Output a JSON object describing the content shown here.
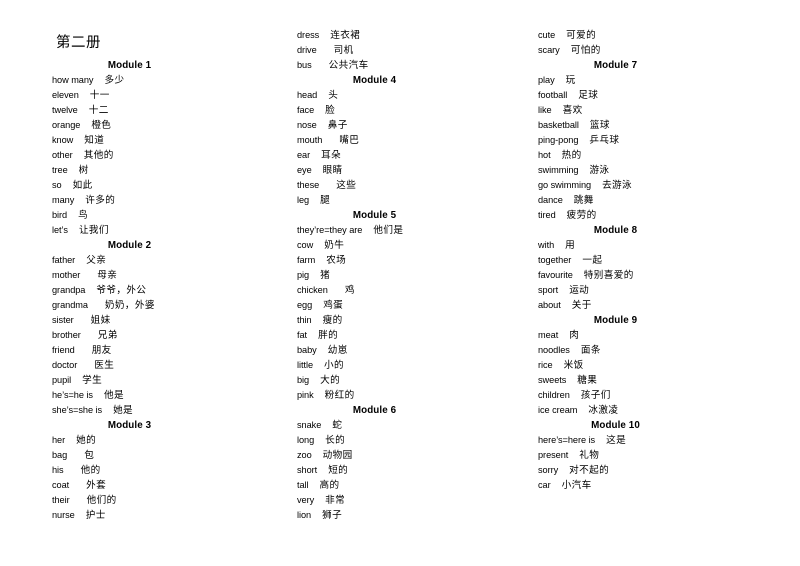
{
  "document": {
    "title": "第二册"
  },
  "columns": [
    {
      "id": "column-1",
      "blocks": [
        {
          "type": "module",
          "label": "Module 1"
        },
        {
          "type": "entry",
          "en": "how  many",
          "gap": "md",
          "zh": "多少"
        },
        {
          "type": "entry",
          "en": "eleven",
          "gap": "md",
          "zh": "十一"
        },
        {
          "type": "entry",
          "en": "twelve",
          "gap": "md",
          "zh": "十二"
        },
        {
          "type": "entry",
          "en": "orange",
          "gap": "md",
          "zh": "橙色"
        },
        {
          "type": "entry",
          "en": "know",
          "gap": "md",
          "zh": "知道"
        },
        {
          "type": "entry",
          "en": "other",
          "gap": "md",
          "zh": "其他的"
        },
        {
          "type": "entry",
          "en": "tree",
          "gap": "md",
          "zh": "树"
        },
        {
          "type": "entry",
          "en": "so",
          "gap": "md",
          "zh": "如此"
        },
        {
          "type": "entry",
          "en": "many",
          "gap": "md",
          "zh": "许多的"
        },
        {
          "type": "entry",
          "en": "bird",
          "gap": "md",
          "zh": "鸟"
        },
        {
          "type": "entry",
          "en": "let’s",
          "gap": "md",
          "zh": "让我们"
        },
        {
          "type": "module",
          "label": "Module 2"
        },
        {
          "type": "entry",
          "en": "father",
          "gap": "md",
          "zh": "父亲"
        },
        {
          "type": "entry",
          "en": "mother",
          "gap": "lg",
          "zh": "母亲"
        },
        {
          "type": "entry",
          "en": "grandpa",
          "gap": "md",
          "zh": "爷爷，外公"
        },
        {
          "type": "entry",
          "en": "grandma",
          "gap": "lg",
          "zh": "奶奶，外婆"
        },
        {
          "type": "entry",
          "en": "sister",
          "gap": "lg",
          "zh": "姐妹"
        },
        {
          "type": "entry",
          "en": "brother",
          "gap": "lg",
          "zh": "兄弟"
        },
        {
          "type": "entry",
          "en": "friend",
          "gap": "lg",
          "zh": "朋友"
        },
        {
          "type": "entry",
          "en": "doctor",
          "gap": "lg",
          "zh": "医生"
        },
        {
          "type": "entry",
          "en": "pupil",
          "gap": "md",
          "zh": "学生"
        },
        {
          "type": "entry",
          "en": "he’s=he   is",
          "gap": "md",
          "zh": "他是"
        },
        {
          "type": "entry",
          "en": "she’s=she   is",
          "gap": "md",
          "zh": "她是"
        },
        {
          "type": "module",
          "label": "Module 3"
        },
        {
          "type": "entry",
          "en": "her",
          "gap": "md",
          "zh": "她的"
        },
        {
          "type": "entry",
          "en": "bag",
          "gap": "lg",
          "zh": "包"
        },
        {
          "type": "entry",
          "en": "his",
          "gap": "lg",
          "zh": "他的"
        },
        {
          "type": "entry",
          "en": "coat",
          "gap": "lg",
          "zh": "外套"
        },
        {
          "type": "entry",
          "en": "their",
          "gap": "lg",
          "zh": "他们的"
        },
        {
          "type": "entry",
          "en": "nurse",
          "gap": "md",
          "zh": "护士"
        }
      ]
    },
    {
      "id": "column-2",
      "blocks": [
        {
          "type": "entry",
          "en": "dress",
          "gap": "md",
          "zh": "连衣裙"
        },
        {
          "type": "entry",
          "en": "drive",
          "gap": "lg",
          "zh": "司机"
        },
        {
          "type": "entry",
          "en": "bus",
          "gap": "lg",
          "zh": "公共汽车"
        },
        {
          "type": "module",
          "label": "Module 4"
        },
        {
          "type": "entry",
          "en": "head",
          "gap": "md",
          "zh": "头"
        },
        {
          "type": "entry",
          "en": "face",
          "gap": "md",
          "zh": "脸"
        },
        {
          "type": "entry",
          "en": "nose",
          "gap": "md",
          "zh": "鼻子"
        },
        {
          "type": "entry",
          "en": "mouth",
          "gap": "lg",
          "zh": "嘴巴"
        },
        {
          "type": "entry",
          "en": "ear",
          "gap": "md",
          "zh": "耳朵"
        },
        {
          "type": "entry",
          "en": "eye",
          "gap": "md",
          "zh": "眼睛"
        },
        {
          "type": "entry",
          "en": "these",
          "gap": "lg",
          "zh": "这些"
        },
        {
          "type": "entry",
          "en": "leg",
          "gap": "md",
          "zh": "腿"
        },
        {
          "type": "module",
          "label": "Module 5"
        },
        {
          "type": "entry",
          "en": "they’re=they   are",
          "gap": "md",
          "zh": "他们是"
        },
        {
          "type": "entry",
          "en": "cow",
          "gap": "md",
          "zh": "奶牛"
        },
        {
          "type": "entry",
          "en": "farm",
          "gap": "md",
          "zh": "农场"
        },
        {
          "type": "entry",
          "en": "pig",
          "gap": "md",
          "zh": "猪"
        },
        {
          "type": "entry",
          "en": "chicken",
          "gap": "lg",
          "zh": "鸡"
        },
        {
          "type": "entry",
          "en": "egg",
          "gap": "md",
          "zh": "鸡蛋"
        },
        {
          "type": "entry",
          "en": "thin",
          "gap": "md",
          "zh": "瘦的"
        },
        {
          "type": "entry",
          "en": "fat",
          "gap": "md",
          "zh": "胖的"
        },
        {
          "type": "entry",
          "en": "baby",
          "gap": "md",
          "zh": "幼崽"
        },
        {
          "type": "entry",
          "en": "little",
          "gap": "md",
          "zh": "小的"
        },
        {
          "type": "entry",
          "en": "big",
          "gap": "md",
          "zh": "大的"
        },
        {
          "type": "entry",
          "en": "pink",
          "gap": "md",
          "zh": "粉红的"
        },
        {
          "type": "module",
          "label": "Module 6"
        },
        {
          "type": "entry",
          "en": "snake",
          "gap": "md",
          "zh": "蛇"
        },
        {
          "type": "entry",
          "en": "long",
          "gap": "md",
          "zh": "长的"
        },
        {
          "type": "entry",
          "en": "zoo",
          "gap": "md",
          "zh": "动物园"
        },
        {
          "type": "entry",
          "en": "short",
          "gap": "md",
          "zh": "短的"
        },
        {
          "type": "entry",
          "en": "tall",
          "gap": "md",
          "zh": "高的"
        },
        {
          "type": "entry",
          "en": "very",
          "gap": "md",
          "zh": "非常"
        },
        {
          "type": "entry",
          "en": "lion",
          "gap": "md",
          "zh": "狮子"
        }
      ]
    },
    {
      "id": "column-3",
      "blocks": [
        {
          "type": "entry",
          "en": "cute",
          "gap": "md",
          "zh": "可爱的"
        },
        {
          "type": "entry",
          "en": "scary",
          "gap": "md",
          "zh": "可怕的"
        },
        {
          "type": "module",
          "label": "Module 7"
        },
        {
          "type": "entry",
          "en": "play",
          "gap": "md",
          "zh": "玩"
        },
        {
          "type": "entry",
          "en": "football",
          "gap": "md",
          "zh": "足球"
        },
        {
          "type": "entry",
          "en": "like",
          "gap": "md",
          "zh": "喜欢"
        },
        {
          "type": "entry",
          "en": "basketball",
          "gap": "md",
          "zh": "篮球"
        },
        {
          "type": "entry",
          "en": "ping-pong",
          "gap": "md",
          "zh": "乒乓球"
        },
        {
          "type": "entry",
          "en": "hot",
          "gap": "md",
          "zh": "热的"
        },
        {
          "type": "entry",
          "en": "swimming",
          "gap": "md",
          "zh": "游泳"
        },
        {
          "type": "entry",
          "en": "go   swimming",
          "gap": "md",
          "zh": "去游泳"
        },
        {
          "type": "entry",
          "en": "dance",
          "gap": "md",
          "zh": "跳舞"
        },
        {
          "type": "entry",
          "en": "tired",
          "gap": "md",
          "zh": "疲劳的"
        },
        {
          "type": "module",
          "label": "Module 8"
        },
        {
          "type": "entry",
          "en": "with",
          "gap": "md",
          "zh": "用"
        },
        {
          "type": "entry",
          "en": "together",
          "gap": "md",
          "zh": "一起"
        },
        {
          "type": "entry",
          "en": "favourite",
          "gap": "md",
          "zh": "特别喜爱的"
        },
        {
          "type": "entry",
          "en": "sport",
          "gap": "md",
          "zh": "运动"
        },
        {
          "type": "entry",
          "en": "about",
          "gap": "md",
          "zh": "关于"
        },
        {
          "type": "module",
          "label": "Module 9"
        },
        {
          "type": "entry",
          "en": "meat",
          "gap": "md",
          "zh": "肉"
        },
        {
          "type": "entry",
          "en": "noodles",
          "gap": "md",
          "zh": "面条"
        },
        {
          "type": "entry",
          "en": "rice",
          "gap": "md",
          "zh": "米饭"
        },
        {
          "type": "entry",
          "en": "sweets",
          "gap": "md",
          "zh": "糖果"
        },
        {
          "type": "entry",
          "en": "children",
          "gap": "md",
          "zh": "孩子们"
        },
        {
          "type": "entry",
          "en": "ice   cream",
          "gap": "md",
          "zh": "冰激凌"
        },
        {
          "type": "module",
          "label": "Module 10"
        },
        {
          "type": "entry",
          "en": "here’s=here   is",
          "gap": "md",
          "zh": "这是"
        },
        {
          "type": "entry",
          "en": "present",
          "gap": "md",
          "zh": "礼物"
        },
        {
          "type": "entry",
          "en": "sorry",
          "gap": "md",
          "zh": "对不起的"
        },
        {
          "type": "entry",
          "en": "car",
          "gap": "md",
          "zh": "小汽车"
        }
      ]
    }
  ]
}
